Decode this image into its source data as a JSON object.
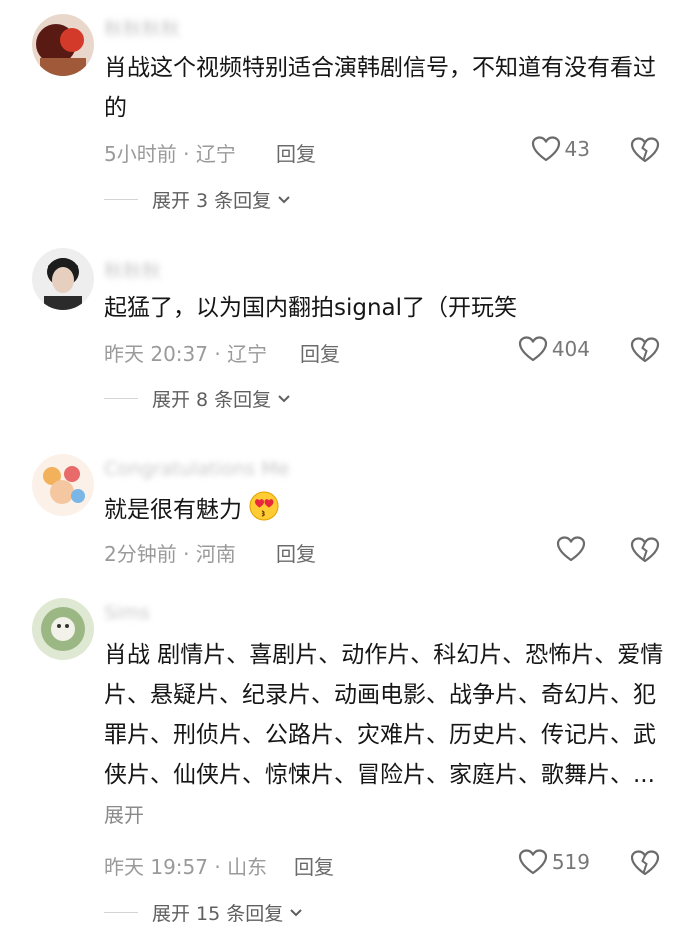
{
  "comments": [
    {
      "username": "秋秋秋秋",
      "text": "肖战这个视频特别适合演韩剧信号，不知道有没有看过的",
      "time": "5小时前",
      "location": "辽宁",
      "reply_label": "回复",
      "likes": "43",
      "expand_label": "展开 3 条回复"
    },
    {
      "username": "秋秋秋",
      "text": "起猛了，以为国内翻拍signal了（开玩笑",
      "time": "昨天 20:37",
      "location": "辽宁",
      "reply_label": "回复",
      "likes": "404",
      "expand_label": "展开 8 条回复"
    },
    {
      "username": "Congratulations Me",
      "text": "就是很有魅力",
      "emoji": "heart-eyes-kiss-emoji",
      "time": "2分钟前",
      "location": "河南",
      "reply_label": "回复",
      "likes": ""
    },
    {
      "username": "Sims",
      "text": "肖战 剧情片、喜剧片、动作片、科幻片、恐怖片、爱情片、悬疑片、纪录片、动画电影、战争片、奇幻片、犯罪片、刑侦片、公路片、灾难片、历史片、传记片、武侠片、仙侠片、惊悚片、冒险片、家庭片、歌舞片、...",
      "more_label": "展开",
      "time": "昨天 19:57",
      "location": "山东",
      "reply_label": "回复",
      "likes": "519",
      "expand_label": "展开 15 条回复"
    }
  ],
  "separator": " · ",
  "icons": {
    "like": "heart-outline-icon",
    "dislike": "broken-heart-icon",
    "chevron": "chevron-down-icon"
  },
  "colors": {
    "text": "#161616",
    "meta": "#9a9a9a",
    "icon": "#6b6b6b"
  }
}
